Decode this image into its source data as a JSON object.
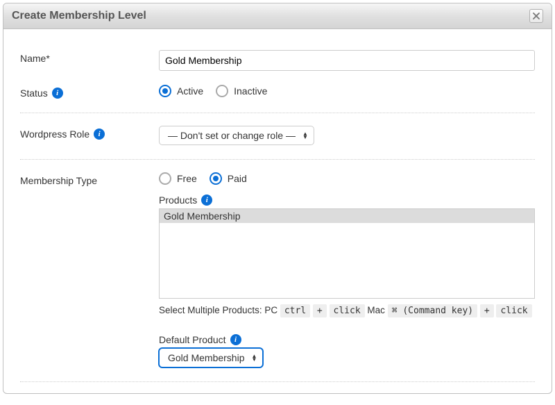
{
  "dialog": {
    "title": "Create Membership Level"
  },
  "form": {
    "name": {
      "label": "Name*",
      "value": "Gold Membership"
    },
    "status": {
      "label": "Status",
      "options": {
        "active": "Active",
        "inactive": "Inactive"
      },
      "selected": "active"
    },
    "wp_role": {
      "label": "Wordpress Role",
      "selected": "— Don't set or change role —"
    },
    "membership_type": {
      "label": "Membership Type",
      "options": {
        "free": "Free",
        "paid": "Paid"
      },
      "selected": "paid"
    },
    "products": {
      "label": "Products",
      "items": [
        "Gold Membership"
      ],
      "selected": "Gold Membership"
    },
    "hint": {
      "prefix": "Select Multiple Products: PC",
      "k1": "ctrl",
      "k2": "+",
      "k3": "click",
      "mac": "Mac",
      "k4": "⌘ (Command key)",
      "k5": "+",
      "k6": "click"
    },
    "default_product": {
      "label": "Default Product",
      "selected": "Gold Membership"
    }
  }
}
